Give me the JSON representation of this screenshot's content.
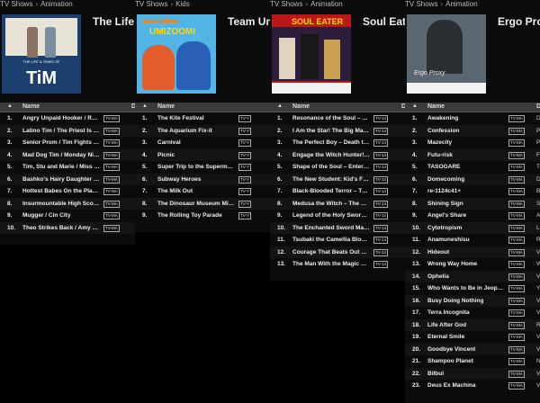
{
  "panels": [
    {
      "breadcrumb": [
        "TV Shows",
        "Animation"
      ],
      "title": "The Life &",
      "art": {
        "type": "tim",
        "caption": "THE LIFE & TIMES OF",
        "big": "TiM"
      },
      "header": {
        "name": "Name",
        "extra": "D"
      },
      "episodes": [
        {
          "num": "1.",
          "name": "Angry Unpaid Hooker / Rodn...",
          "rating": "TV-MA"
        },
        {
          "num": "2.",
          "name": "Latino Tim / The Priest Is Drunk",
          "rating": "TV-MA"
        },
        {
          "num": "3.",
          "name": "Senior Prom / Tim Fights an ...",
          "rating": "TV-MA"
        },
        {
          "num": "4.",
          "name": "Mad Dog Tim / Monday Night...",
          "rating": "TV-MA"
        },
        {
          "num": "5.",
          "name": "Tim, Stu and Marie / Miss Feb...",
          "rating": "TV-MA"
        },
        {
          "num": "6.",
          "name": "Bashko's Hairy Daughter / Ti...",
          "rating": "TV-MA"
        },
        {
          "num": "7.",
          "name": "Hottest Babes On the Planet /...",
          "rating": "TV-MA"
        },
        {
          "num": "8.",
          "name": "Insurmountable High Score /...",
          "rating": "TV-MA"
        },
        {
          "num": "9.",
          "name": "Mugger / Cin City",
          "rating": "TV-MA"
        },
        {
          "num": "10.",
          "name": "Theo Strikes Back / Amy Gets...",
          "rating": "TV-MA"
        }
      ]
    },
    {
      "breadcrumb": [
        "TV Shows",
        "Kids"
      ],
      "title": "Team Um",
      "art": {
        "type": "umi",
        "logo": "nickelodeon",
        "logo2": "UMIZOOMI"
      },
      "header": {
        "name": "Name",
        "extra": ""
      },
      "episodes": [
        {
          "num": "1.",
          "name": "The Kite Festival",
          "rating": "TV-Y"
        },
        {
          "num": "2.",
          "name": "The Aquarium Fix-it",
          "rating": "TV-Y"
        },
        {
          "num": "3.",
          "name": "Carnival",
          "rating": "TV-Y"
        },
        {
          "num": "4.",
          "name": "Picnic",
          "rating": "TV-Y"
        },
        {
          "num": "5.",
          "name": "Super Trip to the Supermarket",
          "rating": "TV-Y"
        },
        {
          "num": "6.",
          "name": "Subway Heroes",
          "rating": "TV-Y"
        },
        {
          "num": "7.",
          "name": "The Milk Out",
          "rating": "TV-Y"
        },
        {
          "num": "8.",
          "name": "The Dinosaur Museum Mishap",
          "rating": "TV-Y"
        },
        {
          "num": "9.",
          "name": "The Rolling Toy Parade",
          "rating": "TV-Y"
        }
      ]
    },
    {
      "breadcrumb": [
        "TV Shows",
        "Animation"
      ],
      "title": "Soul Eate",
      "art": {
        "type": "soul",
        "logo": "SOUL EATER"
      },
      "header": {
        "name": "Name",
        "extra": "D"
      },
      "episodes": [
        {
          "num": "1.",
          "name": "Resonance of the Soul – Will ...",
          "rating": "TV-14"
        },
        {
          "num": "2.",
          "name": "I Am the Star! The Big Man Is...",
          "rating": "TV-14"
        },
        {
          "num": "3.",
          "name": "The Perfect Boy – Death the K...",
          "rating": "TV-14"
        },
        {
          "num": "4.",
          "name": "Engage the Witch Hunter! A R...",
          "rating": "TV-14"
        },
        {
          "num": "5.",
          "name": "Shape of the Soul – Enter the ...",
          "rating": "TV-14"
        },
        {
          "num": "6.",
          "name": "The New Student: Kid's First ...",
          "rating": "TV-14"
        },
        {
          "num": "7.",
          "name": "Black-Blooded Terror – There'...",
          "rating": "TV-14"
        },
        {
          "num": "8.",
          "name": "Medusa the Witch – The One ...",
          "rating": "TV-14"
        },
        {
          "num": "9.",
          "name": "Legend of the Holy Sword – K...",
          "rating": "TV-14"
        },
        {
          "num": "10.",
          "name": "The Enchanted Sword Massa...",
          "rating": "TV-14"
        },
        {
          "num": "11.",
          "name": "Tsubaki the Camellia Blosso...",
          "rating": "TV-14"
        },
        {
          "num": "12.",
          "name": "Courage That Beats Out Fear ...",
          "rating": "TV-14"
        },
        {
          "num": "13.",
          "name": "The Man With the Magic Eye ...",
          "rating": "TV-14"
        }
      ]
    },
    {
      "breadcrumb": [
        "TV Shows",
        "Animation"
      ],
      "title": "Ergo Pro",
      "art": {
        "type": "ergo",
        "logo": "Ergo Proxy"
      },
      "header": {
        "name": "Name",
        "extra": "D"
      },
      "episodes": [
        {
          "num": "1.",
          "name": "Awakening",
          "rating": "TV-MA",
          "d": "D"
        },
        {
          "num": "2.",
          "name": "Confession",
          "rating": "TV-MA",
          "d": "P"
        },
        {
          "num": "3.",
          "name": "Mazecity",
          "rating": "TV-MA",
          "d": "P"
        },
        {
          "num": "4.",
          "name": "Futu-risk",
          "rating": "TV-MA",
          "d": "F"
        },
        {
          "num": "5.",
          "name": "TASOGARE",
          "rating": "TV-MA",
          "d": "T"
        },
        {
          "num": "6.",
          "name": "Domecoming",
          "rating": "TV-MA",
          "d": "D"
        },
        {
          "num": "7.",
          "name": "re-1124c41+",
          "rating": "TV-MA",
          "d": "B"
        },
        {
          "num": "8.",
          "name": "Shining Sign",
          "rating": "TV-MA",
          "d": "S"
        },
        {
          "num": "9.",
          "name": "Angel's Share",
          "rating": "TV-MA",
          "d": "A"
        },
        {
          "num": "10.",
          "name": "Cytotropism",
          "rating": "TV-MA",
          "d": "L"
        },
        {
          "num": "11.",
          "name": "Anamuneshisu",
          "rating": "TV-MA",
          "d": "R"
        },
        {
          "num": "12.",
          "name": "Hideout",
          "rating": "TV-MA",
          "d": "V"
        },
        {
          "num": "13.",
          "name": "Wrong Way Home",
          "rating": "TV-MA",
          "d": "W"
        },
        {
          "num": "14.",
          "name": "Ophelia",
          "rating": "TV-MA",
          "d": "V"
        },
        {
          "num": "15.",
          "name": "Who Wants to Be in Jeopardy!",
          "rating": "TV-MA",
          "d": "Y"
        },
        {
          "num": "16.",
          "name": "Busy Doing Nothing",
          "rating": "TV-MA",
          "d": "V"
        },
        {
          "num": "17.",
          "name": "Terra Incognita",
          "rating": "TV-MA",
          "d": "V"
        },
        {
          "num": "18.",
          "name": "Life After God",
          "rating": "TV-MA",
          "d": "R"
        },
        {
          "num": "19.",
          "name": "Eternal Smile",
          "rating": "TV-MA",
          "d": "V"
        },
        {
          "num": "20.",
          "name": "Goodbye Vincent",
          "rating": "TV-MA",
          "d": "V"
        },
        {
          "num": "21.",
          "name": "Shampoo Planet",
          "rating": "TV-MA",
          "d": "N"
        },
        {
          "num": "22.",
          "name": "Bilbul",
          "rating": "TV-MA",
          "d": "V"
        },
        {
          "num": "23.",
          "name": "Deus Ex Machina",
          "rating": "TV-MA",
          "d": "V"
        }
      ]
    }
  ]
}
